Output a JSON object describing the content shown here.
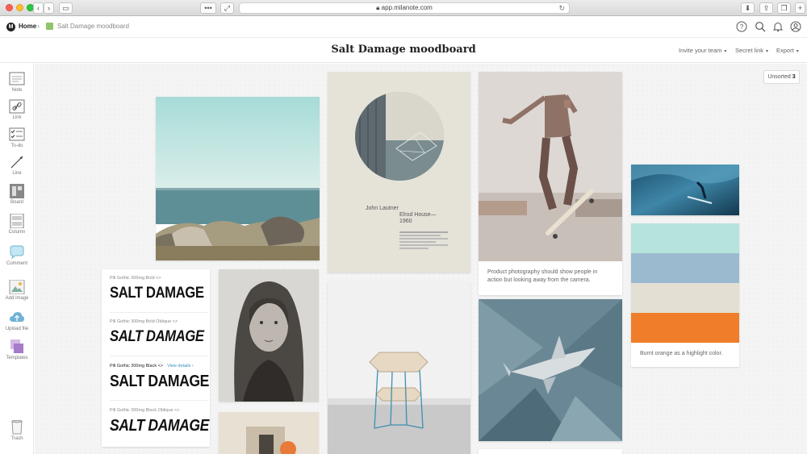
{
  "browser": {
    "url": "app.milanote.com"
  },
  "breadcrumb": {
    "home": "Home",
    "board": "Salt Damage moodboard",
    "separator": "›"
  },
  "board": {
    "title": "Salt Damage moodboard",
    "swatch_color": "#8fc46b"
  },
  "header_menus": {
    "invite": "Invite your team",
    "secret_link": "Secret link",
    "export": "Export",
    "caret": "▾"
  },
  "toolbar": {
    "note": "Note",
    "link": "Link",
    "todo": "To-do",
    "line": "Line",
    "board": "Board",
    "column": "Column",
    "comment": "Comment",
    "add_image": "Add image",
    "upload_file": "Upload file",
    "templates": "Templates",
    "trash": "Trash"
  },
  "unsorted": {
    "label": "Unsorted",
    "count": "3"
  },
  "cards": {
    "poster_text": {
      "line1": "John Lautner",
      "line2": "Elrod House—",
      "line3": "1960"
    },
    "skater_caption": "Product photography should show people in action but looking away from the camera.",
    "palette_caption": "Burnt orange as a highlight color.",
    "palette_colors": [
      "#b6e4dc",
      "#9bbad0",
      "#e3e0d3",
      "#f07d2a"
    ]
  },
  "fonts": {
    "rows": [
      {
        "name": "Pill Gothic 300mg Bold",
        "code": "<>",
        "sample": "SALT DAMAGE"
      },
      {
        "name": "Pill Gothic 300mg Bold Oblique",
        "code": "<>",
        "sample": "SALT DAMAGE"
      },
      {
        "name": "Pill Gothic 300mg Black",
        "code": "<>",
        "view": "View details ›",
        "sample": "SALT DAMAGE"
      },
      {
        "name": "Pill Gothic 300mg Black Oblique",
        "code": "<>",
        "sample": "SALT DAMAGE"
      }
    ]
  }
}
